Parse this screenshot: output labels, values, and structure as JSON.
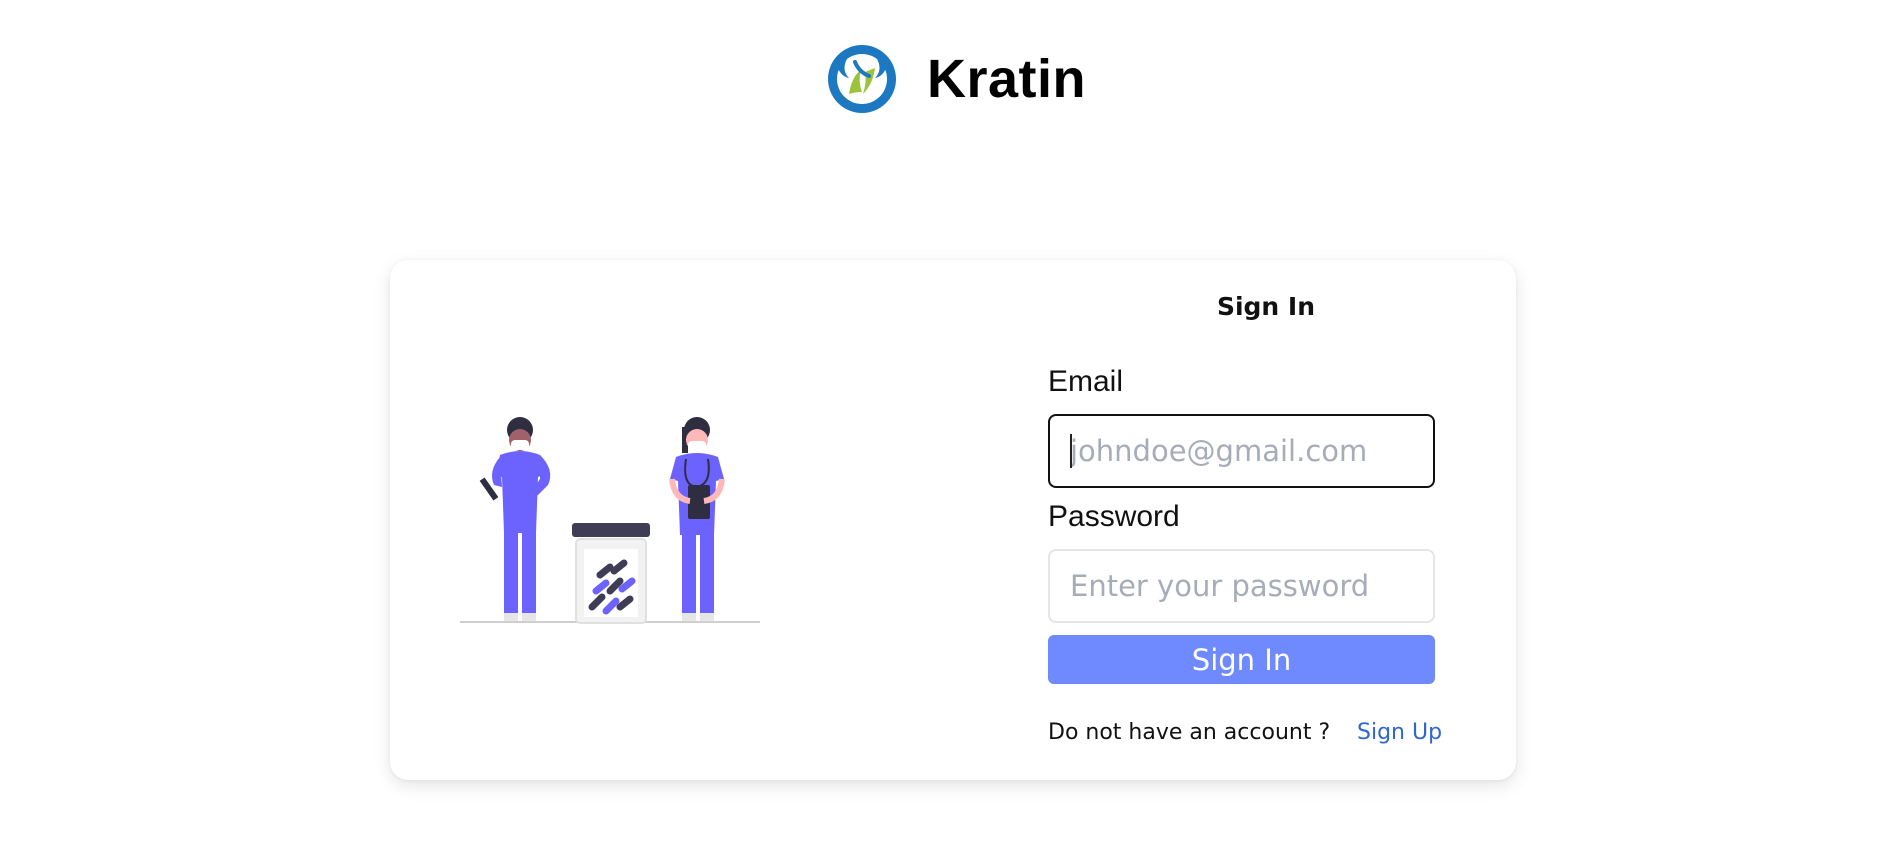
{
  "brand": {
    "name": "Kratin",
    "logo_icon": "kratin-logo-icon"
  },
  "illustration": {
    "icon": "doctors-pill-jar-illustration",
    "accent_color": "#6c63ff"
  },
  "form": {
    "title": "Sign In",
    "email_label": "Email",
    "email_placeholder": "johndoe@gmail.com",
    "email_value": "",
    "password_label": "Password",
    "password_placeholder": "Enter your password",
    "password_value": "",
    "submit_label": "Sign In",
    "no_account_text": "Do not have an account ?",
    "signup_label": "Sign Up"
  },
  "colors": {
    "primary_button": "#6f89ff",
    "link": "#2f66d0",
    "placeholder": "#a6adb8"
  }
}
